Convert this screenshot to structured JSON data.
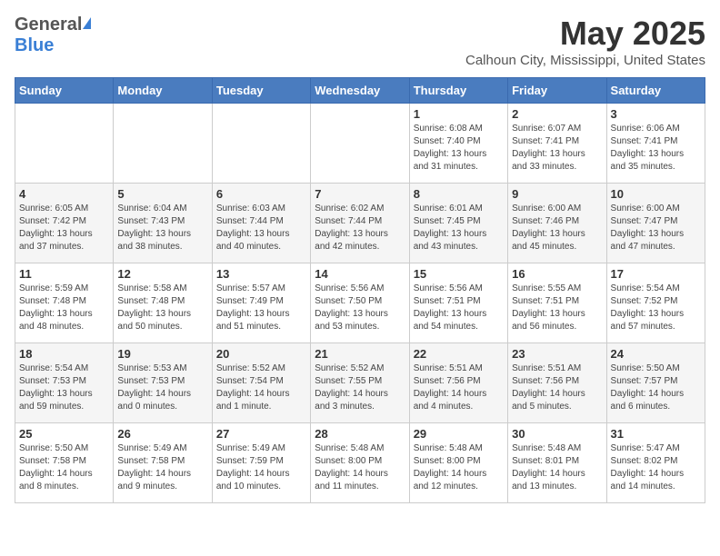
{
  "header": {
    "logo_general": "General",
    "logo_blue": "Blue",
    "month_title": "May 2025",
    "location": "Calhoun City, Mississippi, United States"
  },
  "days_of_week": [
    "Sunday",
    "Monday",
    "Tuesday",
    "Wednesday",
    "Thursday",
    "Friday",
    "Saturday"
  ],
  "weeks": [
    [
      {
        "day": "",
        "info": ""
      },
      {
        "day": "",
        "info": ""
      },
      {
        "day": "",
        "info": ""
      },
      {
        "day": "",
        "info": ""
      },
      {
        "day": "1",
        "sunrise": "Sunrise: 6:08 AM",
        "sunset": "Sunset: 7:40 PM",
        "daylight": "Daylight: 13 hours and 31 minutes."
      },
      {
        "day": "2",
        "sunrise": "Sunrise: 6:07 AM",
        "sunset": "Sunset: 7:41 PM",
        "daylight": "Daylight: 13 hours and 33 minutes."
      },
      {
        "day": "3",
        "sunrise": "Sunrise: 6:06 AM",
        "sunset": "Sunset: 7:41 PM",
        "daylight": "Daylight: 13 hours and 35 minutes."
      }
    ],
    [
      {
        "day": "4",
        "sunrise": "Sunrise: 6:05 AM",
        "sunset": "Sunset: 7:42 PM",
        "daylight": "Daylight: 13 hours and 37 minutes."
      },
      {
        "day": "5",
        "sunrise": "Sunrise: 6:04 AM",
        "sunset": "Sunset: 7:43 PM",
        "daylight": "Daylight: 13 hours and 38 minutes."
      },
      {
        "day": "6",
        "sunrise": "Sunrise: 6:03 AM",
        "sunset": "Sunset: 7:44 PM",
        "daylight": "Daylight: 13 hours and 40 minutes."
      },
      {
        "day": "7",
        "sunrise": "Sunrise: 6:02 AM",
        "sunset": "Sunset: 7:44 PM",
        "daylight": "Daylight: 13 hours and 42 minutes."
      },
      {
        "day": "8",
        "sunrise": "Sunrise: 6:01 AM",
        "sunset": "Sunset: 7:45 PM",
        "daylight": "Daylight: 13 hours and 43 minutes."
      },
      {
        "day": "9",
        "sunrise": "Sunrise: 6:00 AM",
        "sunset": "Sunset: 7:46 PM",
        "daylight": "Daylight: 13 hours and 45 minutes."
      },
      {
        "day": "10",
        "sunrise": "Sunrise: 6:00 AM",
        "sunset": "Sunset: 7:47 PM",
        "daylight": "Daylight: 13 hours and 47 minutes."
      }
    ],
    [
      {
        "day": "11",
        "sunrise": "Sunrise: 5:59 AM",
        "sunset": "Sunset: 7:48 PM",
        "daylight": "Daylight: 13 hours and 48 minutes."
      },
      {
        "day": "12",
        "sunrise": "Sunrise: 5:58 AM",
        "sunset": "Sunset: 7:48 PM",
        "daylight": "Daylight: 13 hours and 50 minutes."
      },
      {
        "day": "13",
        "sunrise": "Sunrise: 5:57 AM",
        "sunset": "Sunset: 7:49 PM",
        "daylight": "Daylight: 13 hours and 51 minutes."
      },
      {
        "day": "14",
        "sunrise": "Sunrise: 5:56 AM",
        "sunset": "Sunset: 7:50 PM",
        "daylight": "Daylight: 13 hours and 53 minutes."
      },
      {
        "day": "15",
        "sunrise": "Sunrise: 5:56 AM",
        "sunset": "Sunset: 7:51 PM",
        "daylight": "Daylight: 13 hours and 54 minutes."
      },
      {
        "day": "16",
        "sunrise": "Sunrise: 5:55 AM",
        "sunset": "Sunset: 7:51 PM",
        "daylight": "Daylight: 13 hours and 56 minutes."
      },
      {
        "day": "17",
        "sunrise": "Sunrise: 5:54 AM",
        "sunset": "Sunset: 7:52 PM",
        "daylight": "Daylight: 13 hours and 57 minutes."
      }
    ],
    [
      {
        "day": "18",
        "sunrise": "Sunrise: 5:54 AM",
        "sunset": "Sunset: 7:53 PM",
        "daylight": "Daylight: 13 hours and 59 minutes."
      },
      {
        "day": "19",
        "sunrise": "Sunrise: 5:53 AM",
        "sunset": "Sunset: 7:53 PM",
        "daylight": "Daylight: 14 hours and 0 minutes."
      },
      {
        "day": "20",
        "sunrise": "Sunrise: 5:52 AM",
        "sunset": "Sunset: 7:54 PM",
        "daylight": "Daylight: 14 hours and 1 minute."
      },
      {
        "day": "21",
        "sunrise": "Sunrise: 5:52 AM",
        "sunset": "Sunset: 7:55 PM",
        "daylight": "Daylight: 14 hours and 3 minutes."
      },
      {
        "day": "22",
        "sunrise": "Sunrise: 5:51 AM",
        "sunset": "Sunset: 7:56 PM",
        "daylight": "Daylight: 14 hours and 4 minutes."
      },
      {
        "day": "23",
        "sunrise": "Sunrise: 5:51 AM",
        "sunset": "Sunset: 7:56 PM",
        "daylight": "Daylight: 14 hours and 5 minutes."
      },
      {
        "day": "24",
        "sunrise": "Sunrise: 5:50 AM",
        "sunset": "Sunset: 7:57 PM",
        "daylight": "Daylight: 14 hours and 6 minutes."
      }
    ],
    [
      {
        "day": "25",
        "sunrise": "Sunrise: 5:50 AM",
        "sunset": "Sunset: 7:58 PM",
        "daylight": "Daylight: 14 hours and 8 minutes."
      },
      {
        "day": "26",
        "sunrise": "Sunrise: 5:49 AM",
        "sunset": "Sunset: 7:58 PM",
        "daylight": "Daylight: 14 hours and 9 minutes."
      },
      {
        "day": "27",
        "sunrise": "Sunrise: 5:49 AM",
        "sunset": "Sunset: 7:59 PM",
        "daylight": "Daylight: 14 hours and 10 minutes."
      },
      {
        "day": "28",
        "sunrise": "Sunrise: 5:48 AM",
        "sunset": "Sunset: 8:00 PM",
        "daylight": "Daylight: 14 hours and 11 minutes."
      },
      {
        "day": "29",
        "sunrise": "Sunrise: 5:48 AM",
        "sunset": "Sunset: 8:00 PM",
        "daylight": "Daylight: 14 hours and 12 minutes."
      },
      {
        "day": "30",
        "sunrise": "Sunrise: 5:48 AM",
        "sunset": "Sunset: 8:01 PM",
        "daylight": "Daylight: 14 hours and 13 minutes."
      },
      {
        "day": "31",
        "sunrise": "Sunrise: 5:47 AM",
        "sunset": "Sunset: 8:02 PM",
        "daylight": "Daylight: 14 hours and 14 minutes."
      }
    ]
  ]
}
